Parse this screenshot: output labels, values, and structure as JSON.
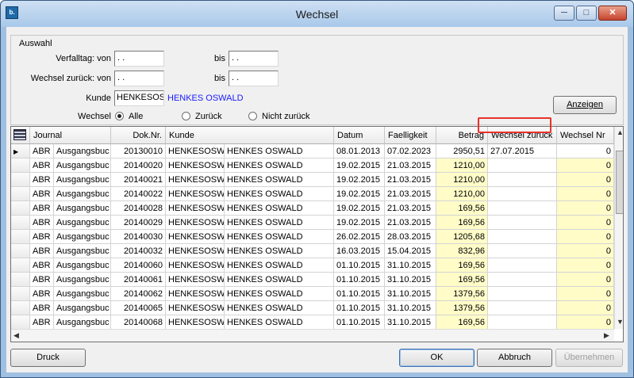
{
  "window": {
    "title": "Wechsel",
    "icon_text": "b."
  },
  "auswahl": {
    "legend": "Auswahl",
    "verfalltag_label": "Verfalltag: von",
    "verfalltag_von": " .  .",
    "verfalltag_bis_label": "bis",
    "verfalltag_bis": " .  .",
    "zurueck_label": "Wechsel zurück: von",
    "zurueck_von": " .  .",
    "zurueck_bis_label": "bis",
    "zurueck_bis": " .  .",
    "kunde_label": "Kunde",
    "kunde_code": "HENKESOSW",
    "kunde_name": "HENKES OSWALD",
    "wechsel_label": "Wechsel",
    "radio_alle": "Alle",
    "radio_zurueck": "Zurück",
    "radio_nicht_zurueck": "Nicht zurück",
    "anzeigen_button": "Anzeigen"
  },
  "grid": {
    "columns": [
      "Journal",
      "Dok.Nr.",
      "Kunde",
      "Datum",
      "Faelligkeit",
      "Betrag",
      "Wechsel zurück",
      "Wechsel Nr"
    ],
    "rows": [
      {
        "j1": "ABR",
        "j2": "Ausgangsbuc",
        "dok": "20130010",
        "kc": "HENKESOSW",
        "kn": "HENKES OSWALD",
        "datum": "08.01.2013",
        "faellig": "07.02.2023",
        "betrag": "2950,51",
        "zurueck": "27.07.2015",
        "nr": "0"
      },
      {
        "j1": "ABR",
        "j2": "Ausgangsbuc",
        "dok": "20140020",
        "kc": "HENKESOSW",
        "kn": "HENKES OSWALD",
        "datum": "19.02.2015",
        "faellig": "21.03.2015",
        "betrag": "1210,00",
        "zurueck": "",
        "nr": "0"
      },
      {
        "j1": "ABR",
        "j2": "Ausgangsbuc",
        "dok": "20140021",
        "kc": "HENKESOSW",
        "kn": "HENKES OSWALD",
        "datum": "19.02.2015",
        "faellig": "21.03.2015",
        "betrag": "1210,00",
        "zurueck": "",
        "nr": "0"
      },
      {
        "j1": "ABR",
        "j2": "Ausgangsbuc",
        "dok": "20140022",
        "kc": "HENKESOSW",
        "kn": "HENKES OSWALD",
        "datum": "19.02.2015",
        "faellig": "21.03.2015",
        "betrag": "1210,00",
        "zurueck": "",
        "nr": "0"
      },
      {
        "j1": "ABR",
        "j2": "Ausgangsbuc",
        "dok": "20140028",
        "kc": "HENKESOSW",
        "kn": "HENKES OSWALD",
        "datum": "19.02.2015",
        "faellig": "21.03.2015",
        "betrag": "169,56",
        "zurueck": "",
        "nr": "0"
      },
      {
        "j1": "ABR",
        "j2": "Ausgangsbuc",
        "dok": "20140029",
        "kc": "HENKESOSW",
        "kn": "HENKES OSWALD",
        "datum": "19.02.2015",
        "faellig": "21.03.2015",
        "betrag": "169,56",
        "zurueck": "",
        "nr": "0"
      },
      {
        "j1": "ABR",
        "j2": "Ausgangsbuc",
        "dok": "20140030",
        "kc": "HENKESOSW",
        "kn": "HENKES OSWALD",
        "datum": "26.02.2015",
        "faellig": "28.03.2015",
        "betrag": "1205,68",
        "zurueck": "",
        "nr": "0"
      },
      {
        "j1": "ABR",
        "j2": "Ausgangsbuc",
        "dok": "20140032",
        "kc": "HENKESOSW",
        "kn": "HENKES OSWALD",
        "datum": "16.03.2015",
        "faellig": "15.04.2015",
        "betrag": "832,96",
        "zurueck": "",
        "nr": "0"
      },
      {
        "j1": "ABR",
        "j2": "Ausgangsbuc",
        "dok": "20140060",
        "kc": "HENKESOSW",
        "kn": "HENKES OSWALD",
        "datum": "01.10.2015",
        "faellig": "31.10.2015",
        "betrag": "169,56",
        "zurueck": "",
        "nr": "0"
      },
      {
        "j1": "ABR",
        "j2": "Ausgangsbuc",
        "dok": "20140061",
        "kc": "HENKESOSW",
        "kn": "HENKES OSWALD",
        "datum": "01.10.2015",
        "faellig": "31.10.2015",
        "betrag": "169,56",
        "zurueck": "",
        "nr": "0"
      },
      {
        "j1": "ABR",
        "j2": "Ausgangsbuc",
        "dok": "20140062",
        "kc": "HENKESOSW",
        "kn": "HENKES OSWALD",
        "datum": "01.10.2015",
        "faellig": "31.10.2015",
        "betrag": "1379,56",
        "zurueck": "",
        "nr": "0"
      },
      {
        "j1": "ABR",
        "j2": "Ausgangsbuc",
        "dok": "20140065",
        "kc": "HENKESOSW",
        "kn": "HENKES OSWALD",
        "datum": "01.10.2015",
        "faellig": "31.10.2015",
        "betrag": "1379,56",
        "zurueck": "",
        "nr": "0"
      },
      {
        "j1": "ABR",
        "j2": "Ausgangsbuc",
        "dok": "20140068",
        "kc": "HENKESOSW",
        "kn": "HENKES OSWALD",
        "datum": "01.10.2015",
        "faellig": "31.10.2015",
        "betrag": "169,56",
        "zurueck": "",
        "nr": "0"
      }
    ]
  },
  "footer": {
    "druck": "Druck",
    "ok": "OK",
    "abbruch": "Abbruch",
    "uebernehmen": "Übernehmen"
  },
  "colors": {
    "highlight_yellow": "#fffcc8",
    "annotation_red": "#e8322a",
    "kunde_name_blue": "#1a1aff"
  }
}
